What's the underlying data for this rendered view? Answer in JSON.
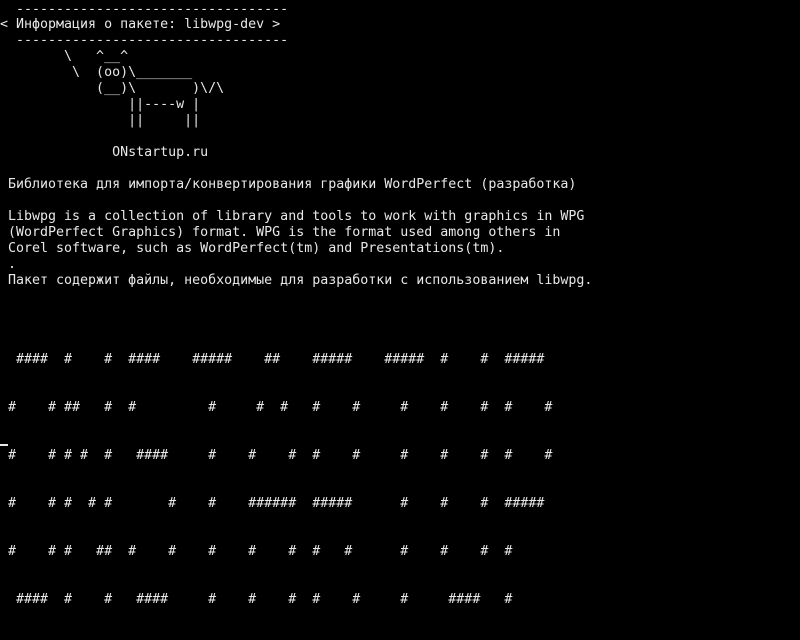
{
  "colors": {
    "background": "#000000",
    "foreground": "#e8e8e8"
  },
  "cowsay": {
    "top_border": " ----------------------------------",
    "message": "< Информация о пакете: libwpg-dev >",
    "bottom_border": " ----------------------------------",
    "cow_lines": [
      "       \\   ^__^",
      "        \\  (oo)\\_______",
      "           (__)\\       )\\/\\",
      "               ||----w |",
      "               ||     ||"
    ],
    "site": "             ONstartup.ru"
  },
  "package": {
    "summary": "Библиотека для импорта/конвертирования графики WordPerfect (разработка)",
    "description": [
      "Libwpg is a collection of library and tools to work with graphics in WPG",
      "(WordPerfect Graphics) format. WPG is the format used among others in",
      "Corel software, such as WordPerfect(tm) and Presentations(tm).",
      ".",
      "Пакет содержит файлы, необходимые для разработки с использованием libwpg."
    ]
  },
  "banner": {
    "lines": [
      " ####  #    #  ####    #####    ##    #####    #####  #    #  #####",
      "#    # ##   #  #         #     #  #   #    #     #    #    #  #    #",
      "#    # # #  #   ####     #    #    #  #    #     #    #    #  #    #",
      "#    # #  # #       #    #    ######  #####      #    #    #  #####",
      "#    # #   ##  #    #    #    #    #  #   #      #    #    #  #",
      " ####  #    #   ####     #    #    #  #    #     #     ####   #"
    ]
  }
}
